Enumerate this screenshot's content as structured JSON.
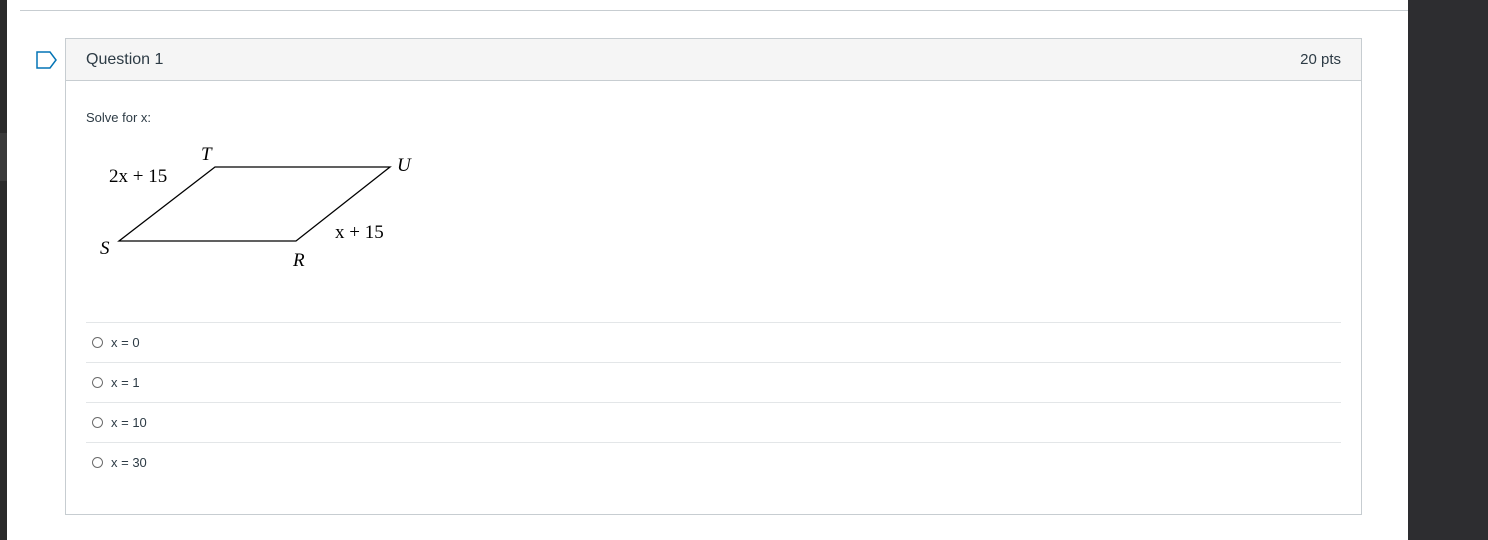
{
  "question": {
    "title": "Question 1",
    "points": "20 pts",
    "prompt": "Solve for x:",
    "figure": {
      "vertex_labels": [
        "T",
        "U",
        "S",
        "R"
      ],
      "side_labels": {
        "st": "2x + 15",
        "ru": "x + 15"
      }
    },
    "answers": [
      {
        "label": "x = 0",
        "selected": false
      },
      {
        "label": "x = 1",
        "selected": false
      },
      {
        "label": "x = 10",
        "selected": false
      },
      {
        "label": "x = 30",
        "selected": false
      }
    ]
  },
  "colors": {
    "border": "#c7cdd1",
    "header_bg": "#f5f5f5",
    "text": "#2d3b45",
    "flag": "#0374b5"
  },
  "icons": {
    "flag": "flag-outline-icon",
    "radio": "radio-unchecked-icon"
  }
}
